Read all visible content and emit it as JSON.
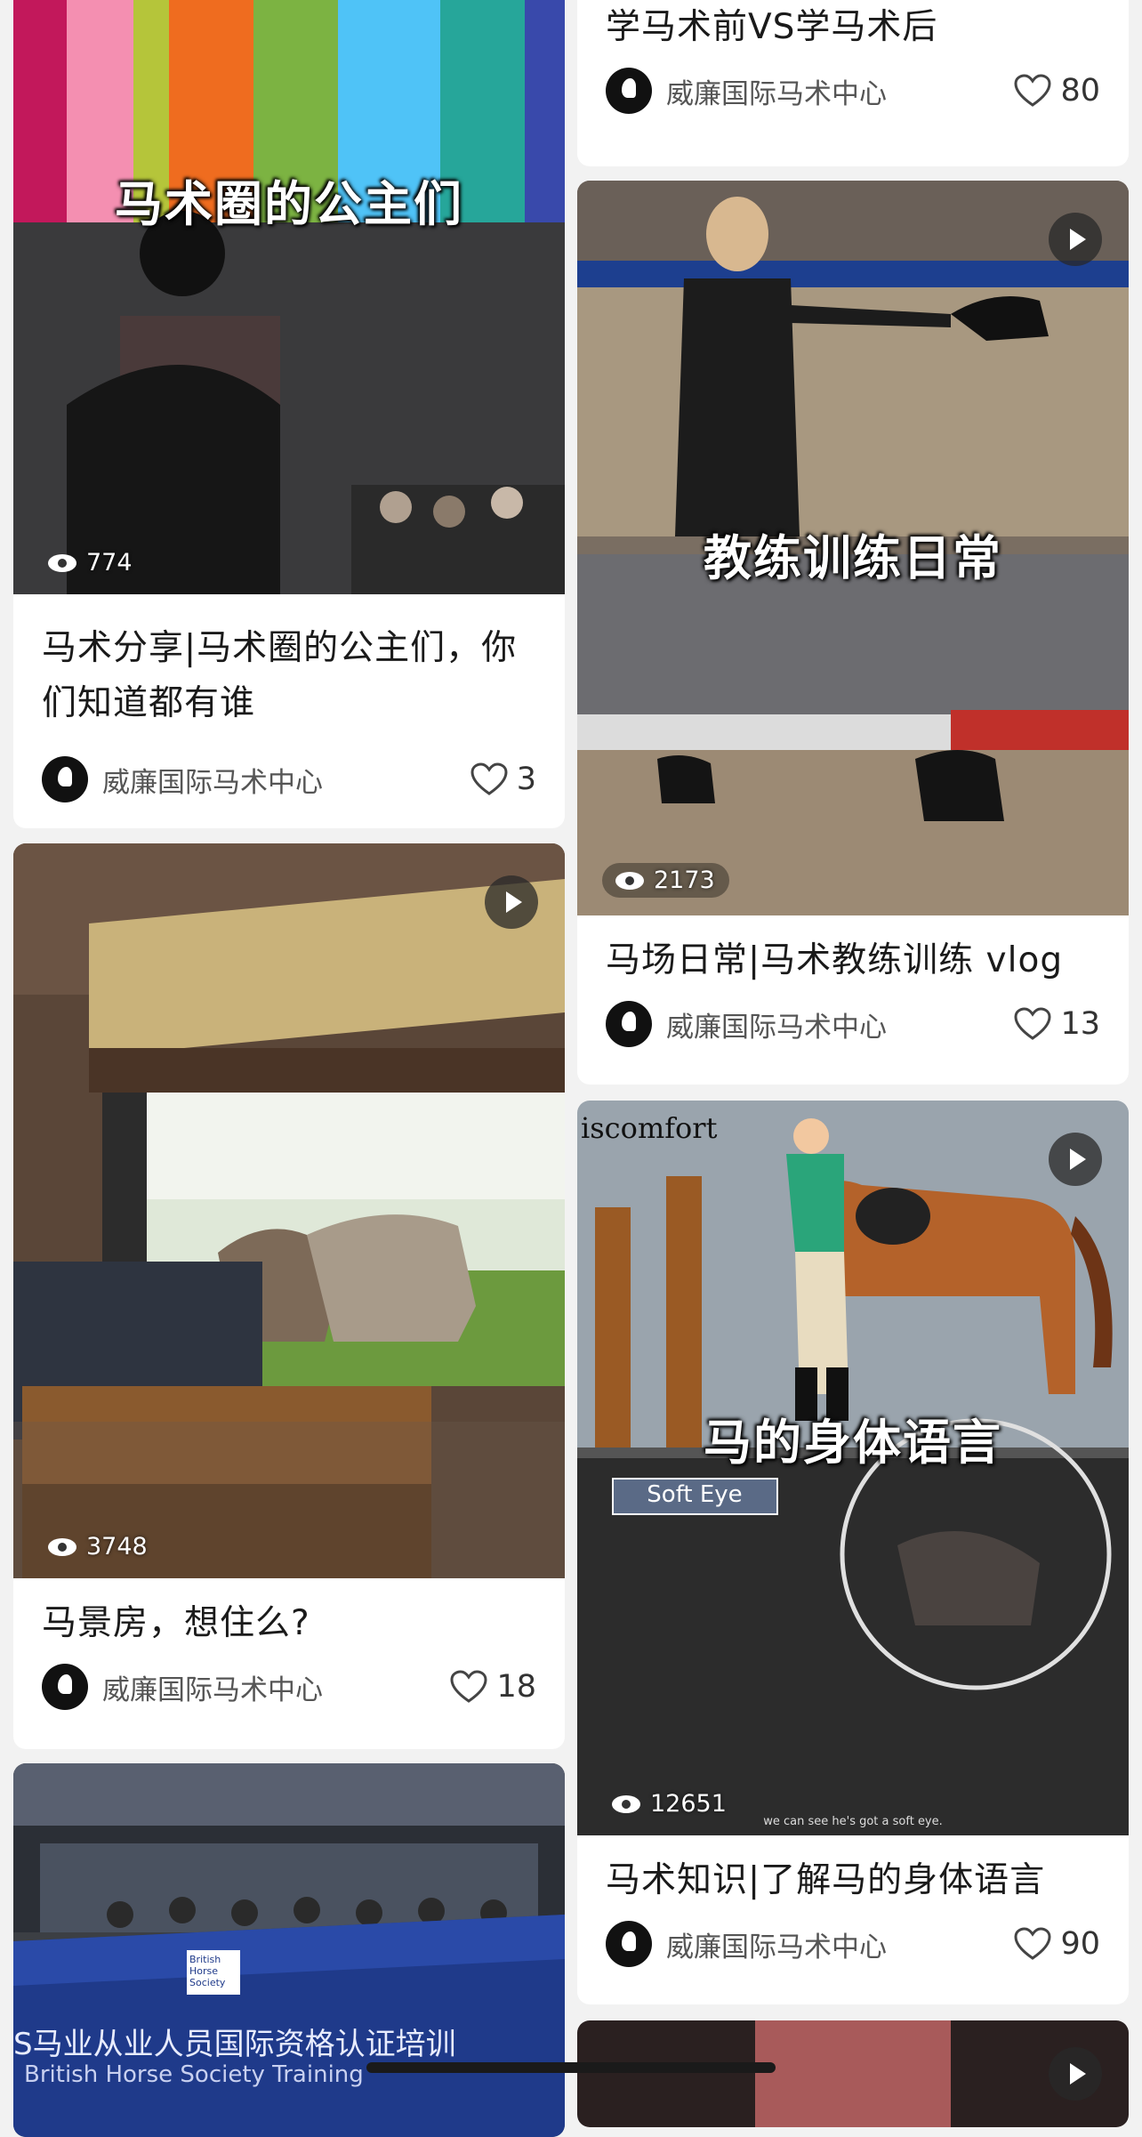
{
  "author_name": "威廉国际马术中心",
  "left_column": [
    {
      "overlay_title": "马术圈的公主们",
      "views": "774",
      "title": "马术分享|马术圈的公主们，你们知道都有谁",
      "likes": "3",
      "has_play": false
    },
    {
      "views": "3748",
      "title": "马景房，想住么?",
      "likes": "18",
      "has_play": true
    },
    {
      "banner_text": "S马业从业人员国际资格认证培训",
      "banner_sub": "British Horse Society Training",
      "badge_text": "British Horse Society"
    }
  ],
  "right_column": [
    {
      "title": "学马术前VS学马术后",
      "likes": "80"
    },
    {
      "overlay_title": "教练训练日常",
      "views": "2173",
      "title": "马场日常|马术教练训练 vlog",
      "likes": "13",
      "has_play": true
    },
    {
      "overlay_title": "马的身体语言",
      "corner_text": "iscomfort",
      "label_text": "Soft Eye",
      "caption_text": "we can see he's got a soft eye.",
      "views": "12651",
      "title": "马术知识|了解马的身体语言",
      "likes": "90",
      "has_play": true
    },
    {
      "has_play": true
    }
  ],
  "icons": {
    "eye": "eye-icon",
    "heart": "heart-icon",
    "play": "play-icon",
    "avatar": "brand-logo-avatar"
  },
  "colors": {
    "background": "#f2f2f2",
    "card": "#ffffff",
    "text": "#1a1a1a",
    "meta": "#555555"
  }
}
